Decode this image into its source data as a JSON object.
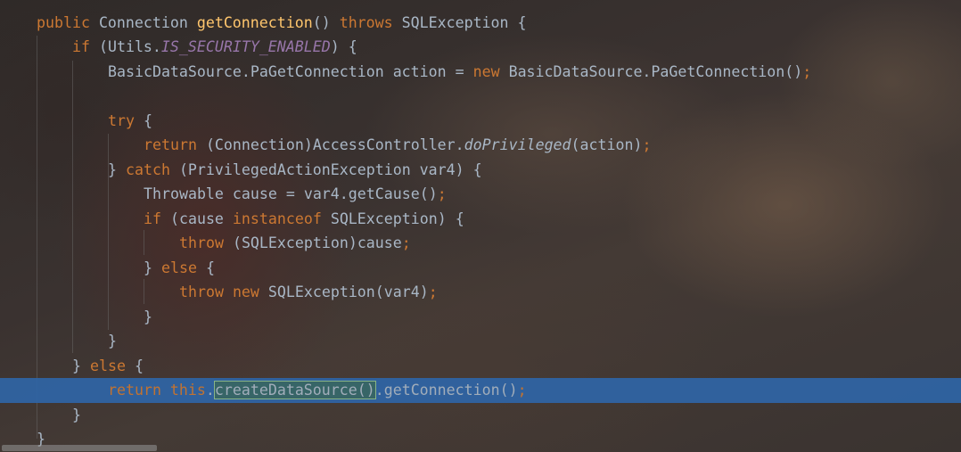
{
  "editor": {
    "language": "java",
    "lines": [
      {
        "tokens": [
          [
            "kw",
            "public "
          ],
          [
            "pl",
            "Connection "
          ],
          [
            "fn",
            "getConnection"
          ],
          [
            "pl",
            "() "
          ],
          [
            "kw",
            "throws "
          ],
          [
            "pl",
            "SQLException {"
          ]
        ]
      },
      {
        "tokens": [
          [
            "kw",
            "if "
          ],
          [
            "pl",
            "(Utils."
          ],
          [
            "st",
            "IS_SECURITY_ENABLED"
          ],
          [
            "pl",
            ") {"
          ]
        ]
      },
      {
        "tokens": [
          [
            "pl",
            "BasicDataSource.PaGetConnection action = "
          ],
          [
            "kw",
            "new "
          ],
          [
            "pl",
            "BasicDataSource.PaGetConnection()"
          ],
          [
            "kw",
            ";"
          ]
        ]
      },
      {
        "tokens": []
      },
      {
        "tokens": [
          [
            "kw",
            "try "
          ],
          [
            "pl",
            "{"
          ]
        ]
      },
      {
        "tokens": [
          [
            "kw",
            "return "
          ],
          [
            "pl",
            "(Connection)AccessController."
          ],
          [
            "it",
            "doPrivileged"
          ],
          [
            "pl",
            "(action)"
          ],
          [
            "kw",
            ";"
          ]
        ]
      },
      {
        "tokens": [
          [
            "pl",
            "} "
          ],
          [
            "kw",
            "catch "
          ],
          [
            "pl",
            "(PrivilegedActionException var4) {"
          ]
        ]
      },
      {
        "tokens": [
          [
            "pl",
            "Throwable cause = var4.getCause()"
          ],
          [
            "kw",
            ";"
          ]
        ]
      },
      {
        "tokens": [
          [
            "kw",
            "if "
          ],
          [
            "pl",
            "(cause "
          ],
          [
            "kw",
            "instanceof "
          ],
          [
            "pl",
            "SQLException) {"
          ]
        ]
      },
      {
        "tokens": [
          [
            "kw",
            "throw "
          ],
          [
            "pl",
            "(SQLException)cause"
          ],
          [
            "kw",
            ";"
          ]
        ]
      },
      {
        "tokens": [
          [
            "pl",
            "} "
          ],
          [
            "kw",
            "else "
          ],
          [
            "pl",
            "{"
          ]
        ]
      },
      {
        "tokens": [
          [
            "kw",
            "throw new "
          ],
          [
            "pl",
            "SQLException(var4)"
          ],
          [
            "kw",
            ";"
          ]
        ]
      },
      {
        "tokens": [
          [
            "pl",
            "}"
          ]
        ]
      },
      {
        "tokens": [
          [
            "pl",
            "}"
          ]
        ]
      },
      {
        "tokens": [
          [
            "pl",
            "} "
          ],
          [
            "kw",
            "else "
          ],
          [
            "pl",
            "{"
          ]
        ]
      },
      {
        "tokens": [
          [
            "kw",
            "return this"
          ],
          [
            "pl",
            "."
          ],
          [
            "match",
            "createDataSource()"
          ],
          [
            "pl",
            ".getConnection()"
          ],
          [
            "kw",
            ";"
          ]
        ],
        "highlighted": true
      },
      {
        "tokens": [
          [
            "pl",
            "}"
          ]
        ]
      },
      {
        "tokens": [
          [
            "pl",
            "}"
          ]
        ]
      }
    ]
  },
  "colors": {
    "keyword": "#cc7832",
    "method_decl": "#ffc66d",
    "static_field": "#9876aa",
    "plain": "#a9b7c6",
    "selection_line": "#2f65a6",
    "brace_match": "#8fbf8f"
  }
}
